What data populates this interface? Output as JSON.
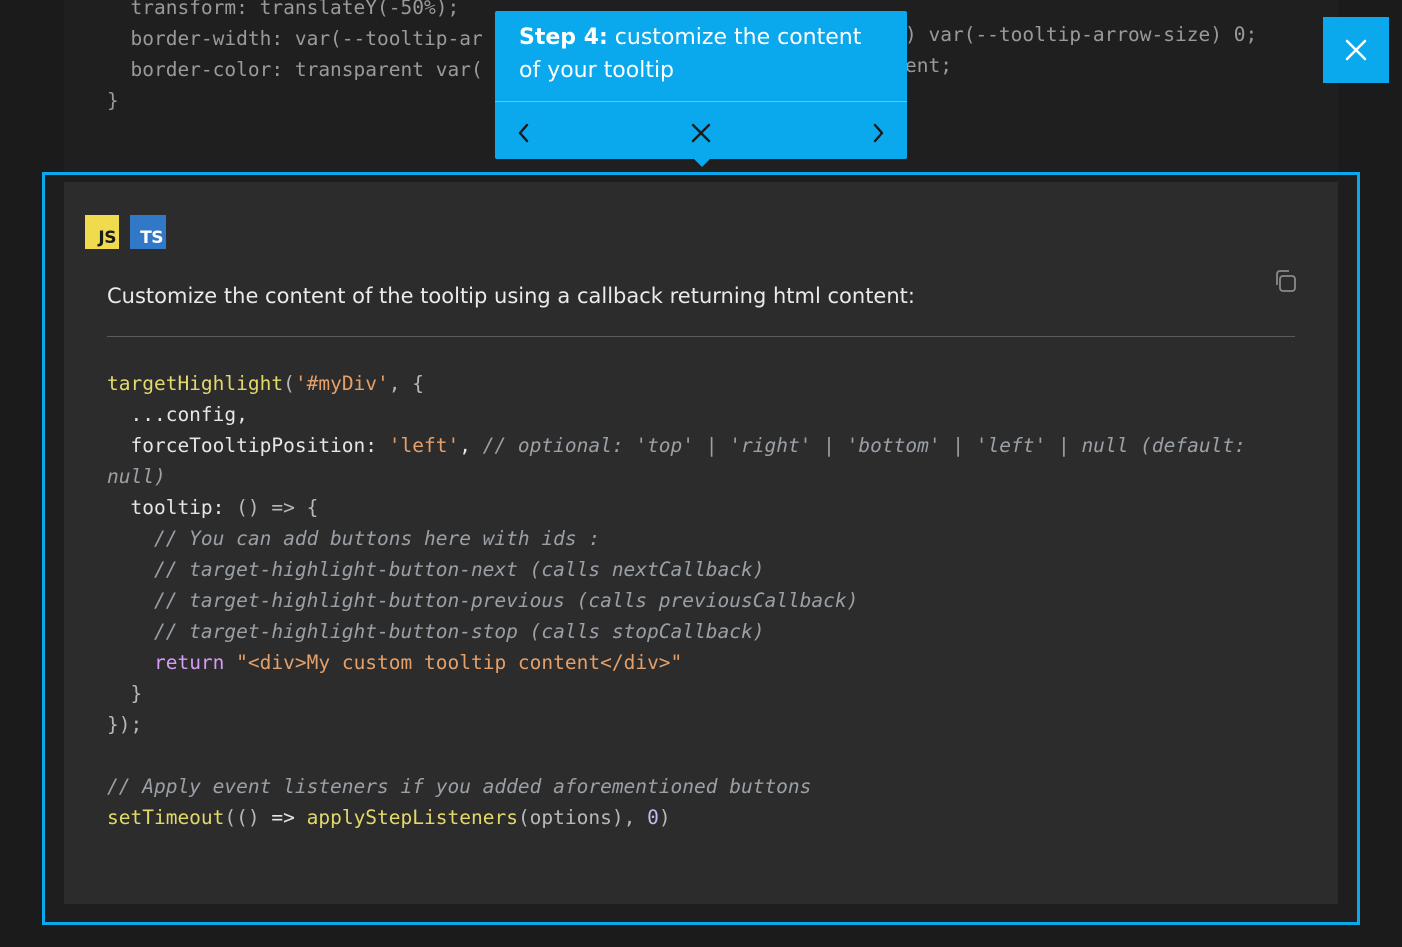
{
  "background_code": {
    "lines": [
      "  transform: translateY(-50%);",
      "  border-width: var(--tooltip-ar",
      "  border-color: transparent var(",
      "}"
    ],
    "right_lines": [
      ") var(--tooltip-arrow-size) 0;",
      "ent;"
    ]
  },
  "tooltip": {
    "step_label": "Step 4:",
    "text": " customize the content of your tooltip",
    "prev_icon": "chevron-left-icon",
    "stop_icon": "close-icon",
    "next_icon": "chevron-right-icon"
  },
  "close_button_icon": "close-icon",
  "card": {
    "badges": {
      "js": "JS",
      "ts": "TS"
    },
    "description": "Customize the content of the tooltip using a callback returning html content:",
    "copy_icon": "copy-icon"
  },
  "code": {
    "l1": {
      "fn": "targetHighlight",
      "p1": "(",
      "str": "'#myDiv'",
      "p2": ", {"
    },
    "l2": "  ...config,",
    "l3": {
      "key": "  forceTooltipPosition: ",
      "str": "'left'",
      "p": ", ",
      "comment": "// optional: 'top' | 'right' | 'bottom' | 'left' | null (default:"
    },
    "l4": "null)",
    "l5": {
      "key": "  tooltip: ",
      "p": "() => {"
    },
    "l6": "    // You can add buttons here with ids :",
    "l7": "    // target-highlight-button-next (calls nextCallback)",
    "l8": "    // target-highlight-button-previous (calls previousCallback)",
    "l9": "    // target-highlight-button-stop (calls stopCallback)",
    "l10": {
      "indent": "    ",
      "kw": "return",
      "sp": " ",
      "str": "\"<div>My custom tooltip content</div>\""
    },
    "l11": "  }",
    "l12": "});",
    "l14": "// Apply event listeners if you added aforementioned buttons",
    "l15": {
      "fn1": "setTimeout",
      "p1": "(() ",
      "arrow": "=> ",
      "fn2": "applyStepListeners",
      "p2": "(options), ",
      "num": "0",
      "p3": ")"
    }
  },
  "colors": {
    "accent": "#0aa8ec",
    "js_badge": "#f0db4f",
    "ts_badge": "#3178c6"
  }
}
